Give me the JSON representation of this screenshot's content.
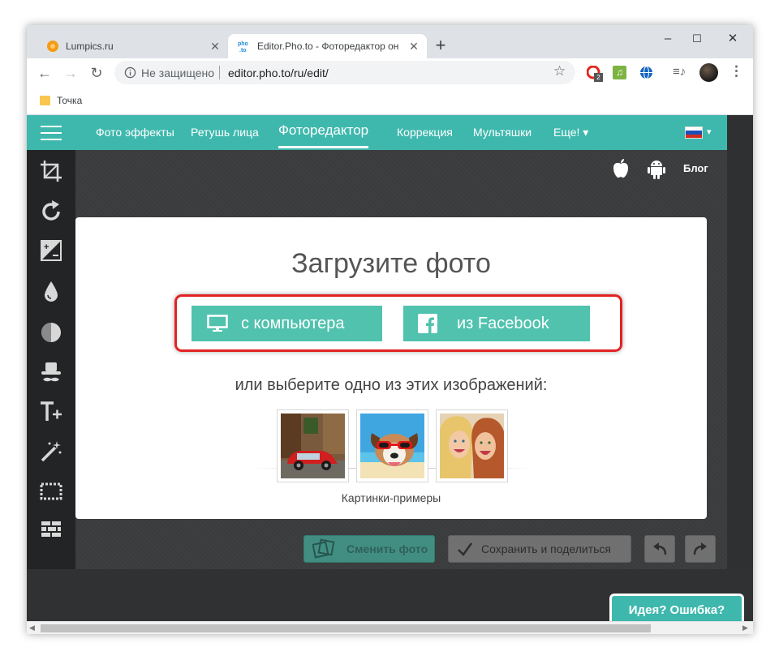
{
  "browser": {
    "tabs": [
      {
        "title": "Lumpics.ru",
        "active": false
      },
      {
        "title": "Editor.Pho.to - Фоторедактор он",
        "active": true
      }
    ],
    "new_tab": "+",
    "window_controls": {
      "minimize": "–",
      "maximize": "☐",
      "close": "✕"
    },
    "security_label": "Не защищено",
    "url": "editor.pho.to/ru/edit/",
    "extension_badge": "2",
    "bookmark": "Точка"
  },
  "site_nav": {
    "items": [
      "Фото эффекты",
      "Ретушь лица",
      "Фоторедактор",
      "Коррекция",
      "Мультяшки",
      "Еще! ▾"
    ],
    "active_index": 2,
    "blog": "Блог",
    "language_caret": "▾"
  },
  "left_tools": [
    "crop-icon",
    "rotate-icon",
    "exposure-icon",
    "color-drop-icon",
    "contrast-icon",
    "hat-mustache-icon",
    "text-add-icon",
    "magic-wand-icon",
    "frame-icon",
    "texture-icon"
  ],
  "upload": {
    "heading": "Загрузите фото",
    "from_computer": "с компьютера",
    "from_facebook": "из Facebook",
    "or_choose": "или выберите одно из этих изображений:",
    "samples_caption": "Картинки-примеры",
    "samples": [
      "red-car-street",
      "dog-sunglasses-beach",
      "two-girls-selfie"
    ]
  },
  "actions": {
    "change_photo": "Сменить фото",
    "save_share": "Сохранить и поделиться"
  },
  "feedback_button": "Идея? Ошибка?",
  "colors": {
    "teal": "#3eb8ad",
    "button_green": "#50c2ae",
    "highlight_red": "#e32222",
    "dark_bg": "#36383a"
  }
}
